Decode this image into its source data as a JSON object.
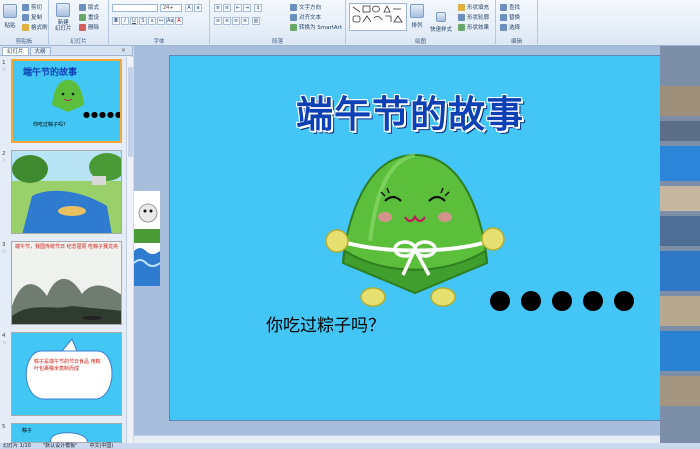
{
  "ribbon": {
    "clipboard": {
      "paste": "粘贴",
      "cut": "剪切",
      "copy": "复制",
      "format_painter": "格式刷",
      "label": "剪贴板"
    },
    "slides": {
      "new_slide": "新建\n幻灯片",
      "layout": "版式",
      "reset": "重设",
      "delete": "删除",
      "label": "幻灯片"
    },
    "font": {
      "size": "24+",
      "label": "字体"
    },
    "paragraph": {
      "text_direction": "文字方向",
      "align_text": "对齐文本",
      "smartart": "转换为 SmartArt",
      "label": "段落"
    },
    "drawing": {
      "arrange": "排列",
      "quick_styles": "快速样式",
      "shape_fill": "形状填充",
      "shape_outline": "形状轮廓",
      "shape_effects": "形状效果",
      "label": "绘图"
    },
    "editing": {
      "find": "查找",
      "replace": "替换",
      "select": "选择",
      "label": "编辑"
    }
  },
  "panel": {
    "tabs": [
      "幻灯片",
      "大纲"
    ],
    "close": "×",
    "slide_numbers": [
      "1",
      "2",
      "3",
      "4",
      "5"
    ],
    "slide1_title": "端午节的故事",
    "slide1_question": "你吃过粽子吗？",
    "slide1_dots": "●●●●●",
    "slide3_text": "端午节，我国传统节日 纪念屈原 吃粽子赛龙舟",
    "slide4_text": "粽子是端午节的节日食品 用粽叶包裹糯米蒸制而成",
    "slide5_text": "粽子"
  },
  "slide": {
    "title": "端午节的故事",
    "question": "你吃过粽子吗？"
  },
  "status": {
    "slide_count": "幻灯片 1/10",
    "theme": "\"默认设计模板\"",
    "language": "中文(中国)"
  },
  "colors": {
    "slide_bg": "#43c6f5",
    "title": "#0d3fb5",
    "zongzi": "#5cbf3c",
    "thumb_selected": "#f3a83a"
  }
}
